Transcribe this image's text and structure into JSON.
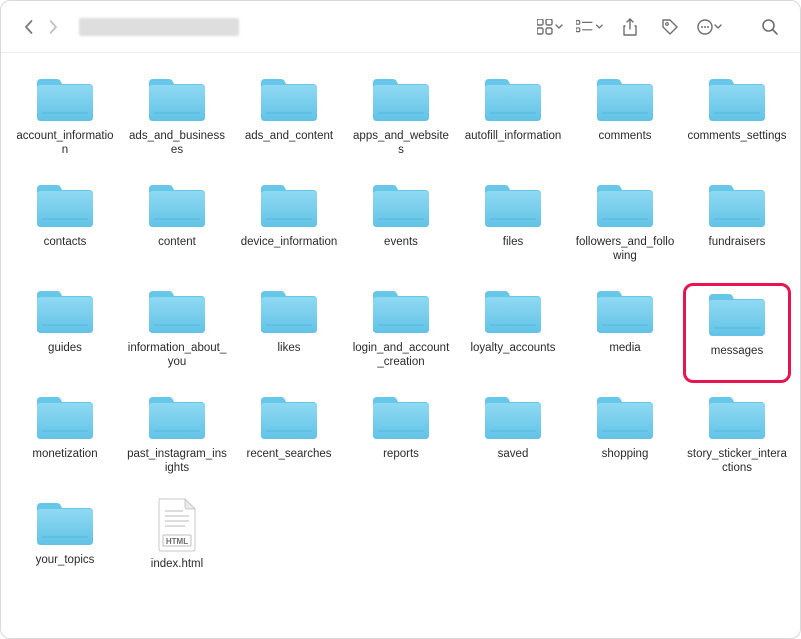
{
  "toolbar": {
    "back_icon": "chevron-left",
    "forward_icon": "chevron-right",
    "window_title_redacted": "",
    "view_icon": "grid-view",
    "group_icon": "group-by",
    "share_icon": "share",
    "tag_icon": "tag",
    "more_icon": "more-circle",
    "search_icon": "search"
  },
  "highlighted_item": "messages",
  "items": [
    {
      "name": "account_information",
      "type": "folder"
    },
    {
      "name": "ads_and_businesses",
      "type": "folder"
    },
    {
      "name": "ads_and_content",
      "type": "folder"
    },
    {
      "name": "apps_and_websites",
      "type": "folder"
    },
    {
      "name": "autofill_information",
      "type": "folder"
    },
    {
      "name": "comments",
      "type": "folder"
    },
    {
      "name": "comments_settings",
      "type": "folder"
    },
    {
      "name": "contacts",
      "type": "folder"
    },
    {
      "name": "content",
      "type": "folder"
    },
    {
      "name": "device_information",
      "type": "folder"
    },
    {
      "name": "events",
      "type": "folder"
    },
    {
      "name": "files",
      "type": "folder"
    },
    {
      "name": "followers_and_following",
      "type": "folder"
    },
    {
      "name": "fundraisers",
      "type": "folder"
    },
    {
      "name": "guides",
      "type": "folder"
    },
    {
      "name": "information_about_you",
      "type": "folder"
    },
    {
      "name": "likes",
      "type": "folder"
    },
    {
      "name": "login_and_account_creation",
      "type": "folder"
    },
    {
      "name": "loyalty_accounts",
      "type": "folder"
    },
    {
      "name": "media",
      "type": "folder"
    },
    {
      "name": "messages",
      "type": "folder"
    },
    {
      "name": "monetization",
      "type": "folder"
    },
    {
      "name": "past_instagram_insights",
      "type": "folder"
    },
    {
      "name": "recent_searches",
      "type": "folder"
    },
    {
      "name": "reports",
      "type": "folder"
    },
    {
      "name": "saved",
      "type": "folder"
    },
    {
      "name": "shopping",
      "type": "folder"
    },
    {
      "name": "story_sticker_interactions",
      "type": "folder"
    },
    {
      "name": "your_topics",
      "type": "folder"
    },
    {
      "name": "index.html",
      "type": "html-file"
    }
  ],
  "file_badge_text": "HTML"
}
